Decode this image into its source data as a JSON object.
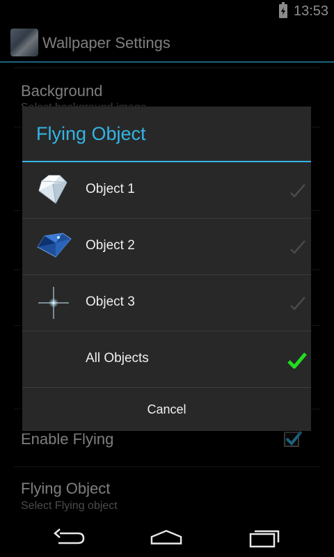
{
  "status_bar": {
    "time": "13:53",
    "battery_icon": "battery-charging-icon"
  },
  "action_bar": {
    "title": "Wallpaper Settings",
    "icon": "app-icon"
  },
  "background_settings": {
    "items": [
      {
        "title": "Background",
        "summary": "Select background image"
      },
      {
        "title": "Enable Flying",
        "checked": true
      },
      {
        "title": "Flying Object",
        "summary": "Select Flying object"
      }
    ]
  },
  "dialog": {
    "title": "Flying Object",
    "options": [
      {
        "label": "Object 1",
        "thumb": "white-diamond-icon",
        "selected": false
      },
      {
        "label": "Object 2",
        "thumb": "blue-diamond-icon",
        "selected": false
      },
      {
        "label": "Object 3",
        "thumb": "sparkle-star-icon",
        "selected": false
      },
      {
        "label": "All Objects",
        "thumb": "",
        "selected": true
      }
    ],
    "cancel_label": "Cancel",
    "accent_color": "#33b5e5",
    "check_color": "#22dd22"
  },
  "nav_bar": {
    "buttons": [
      "back-icon",
      "home-icon",
      "recent-apps-icon"
    ]
  }
}
